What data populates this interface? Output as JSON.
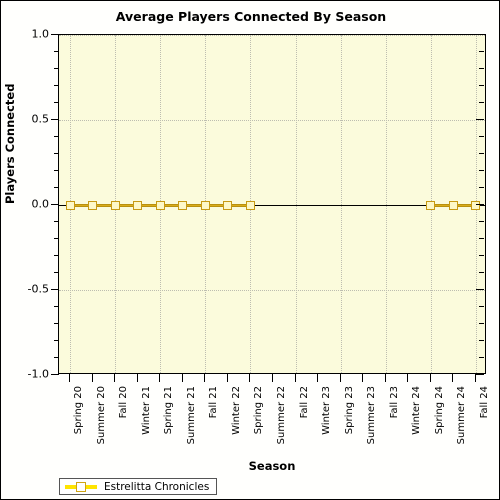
{
  "chart_data": {
    "type": "line",
    "title": "Average Players Connected By Season",
    "xlabel": "Season",
    "ylabel": "Players Connected",
    "ylim": [
      -1.0,
      1.0
    ],
    "ytick_labels": [
      "1.0",
      "0.5",
      "0.0",
      "-0.5",
      "-1.0"
    ],
    "ytick_values": [
      1.0,
      0.5,
      0.0,
      -0.5,
      -1.0
    ],
    "ytick_minor_step": 0.1,
    "grid": true,
    "legend_position": "below-left",
    "categories": [
      "Spring 20",
      "Summer 20",
      "Fall 20",
      "Winter 21",
      "Spring 21",
      "Summer 21",
      "Fall 21",
      "Winter 22",
      "Spring 22",
      "Summer 22",
      "Fall 22",
      "Winter 23",
      "Spring 23",
      "Summer 23",
      "Fall 23",
      "Winter 24",
      "Spring 24",
      "Summer 24",
      "Fall 24"
    ],
    "series": [
      {
        "name": "Estrelitta Chronicles",
        "color": "#d9ac1b",
        "values": [
          0,
          0,
          0,
          0,
          0,
          0,
          0,
          0,
          0,
          null,
          null,
          null,
          null,
          null,
          null,
          null,
          0,
          0,
          0
        ]
      }
    ]
  },
  "legend": {
    "entries": [
      {
        "label": "Estrelitta Chronicles"
      }
    ]
  },
  "colors": {
    "plot_background": "#fbfbdc",
    "figure_background": "#fffffd",
    "series": "#d9ac1b",
    "marker_fill": "#fdf8c8",
    "marker_edge": "#c79a14",
    "grid": "#bdbdb0",
    "axis": "#000000",
    "legend_line": "#ffe400"
  }
}
